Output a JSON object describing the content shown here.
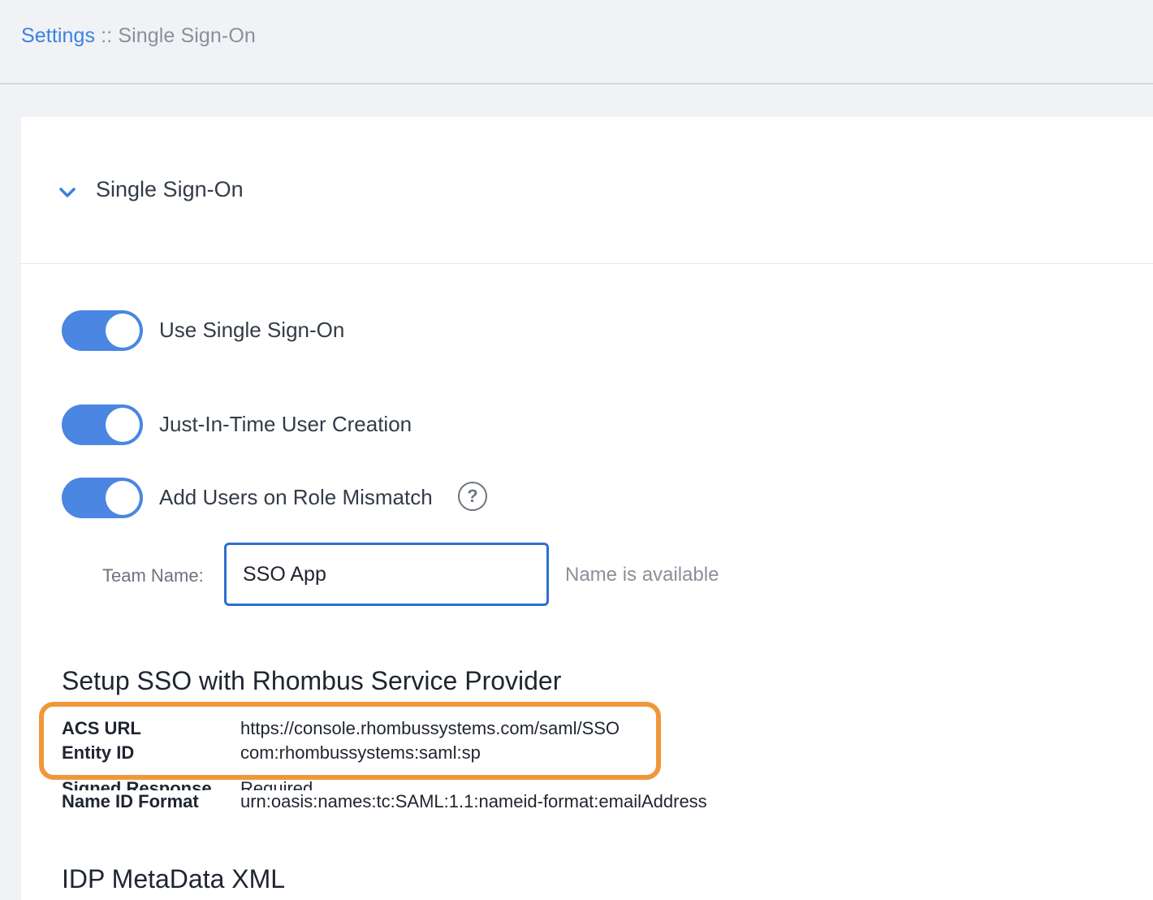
{
  "breadcrumb": {
    "parent": "Settings",
    "separator": " :: ",
    "current": "Single Sign-On"
  },
  "section": {
    "title": "Single Sign-On",
    "expand_icon": "chevron-down-icon"
  },
  "toggles": [
    {
      "label": "Use Single Sign-On",
      "on": true
    },
    {
      "label": "Just-In-Time User Creation",
      "on": true
    },
    {
      "label": "Add Users on Role Mismatch",
      "on": true
    }
  ],
  "help_icon": {
    "glyph": "?",
    "name": "question-circle-icon"
  },
  "team_name": {
    "label": "Team Name:",
    "value": "SSO App",
    "status": "Name is available"
  },
  "service_provider": {
    "heading": "Setup SSO with Rhombus Service Provider",
    "rows": [
      {
        "label": "ACS URL",
        "value": "https://console.rhombussystems.com/saml/SSO"
      },
      {
        "label": "Entity ID",
        "value": "com:rhombussystems:saml:sp"
      },
      {
        "label": "Signed Response",
        "value": "Required"
      },
      {
        "label": "Name ID Format",
        "value": "urn:oasis:names:tc:SAML:1.1:nameid-format:emailAddress"
      }
    ]
  },
  "idp": {
    "heading": "IDP MetaData XML"
  },
  "colors": {
    "accent": "#4a86e2",
    "link": "#3b82e0",
    "input_border": "#2f6fcf",
    "highlight": "#f0973a",
    "background": "#f1f2f6"
  }
}
